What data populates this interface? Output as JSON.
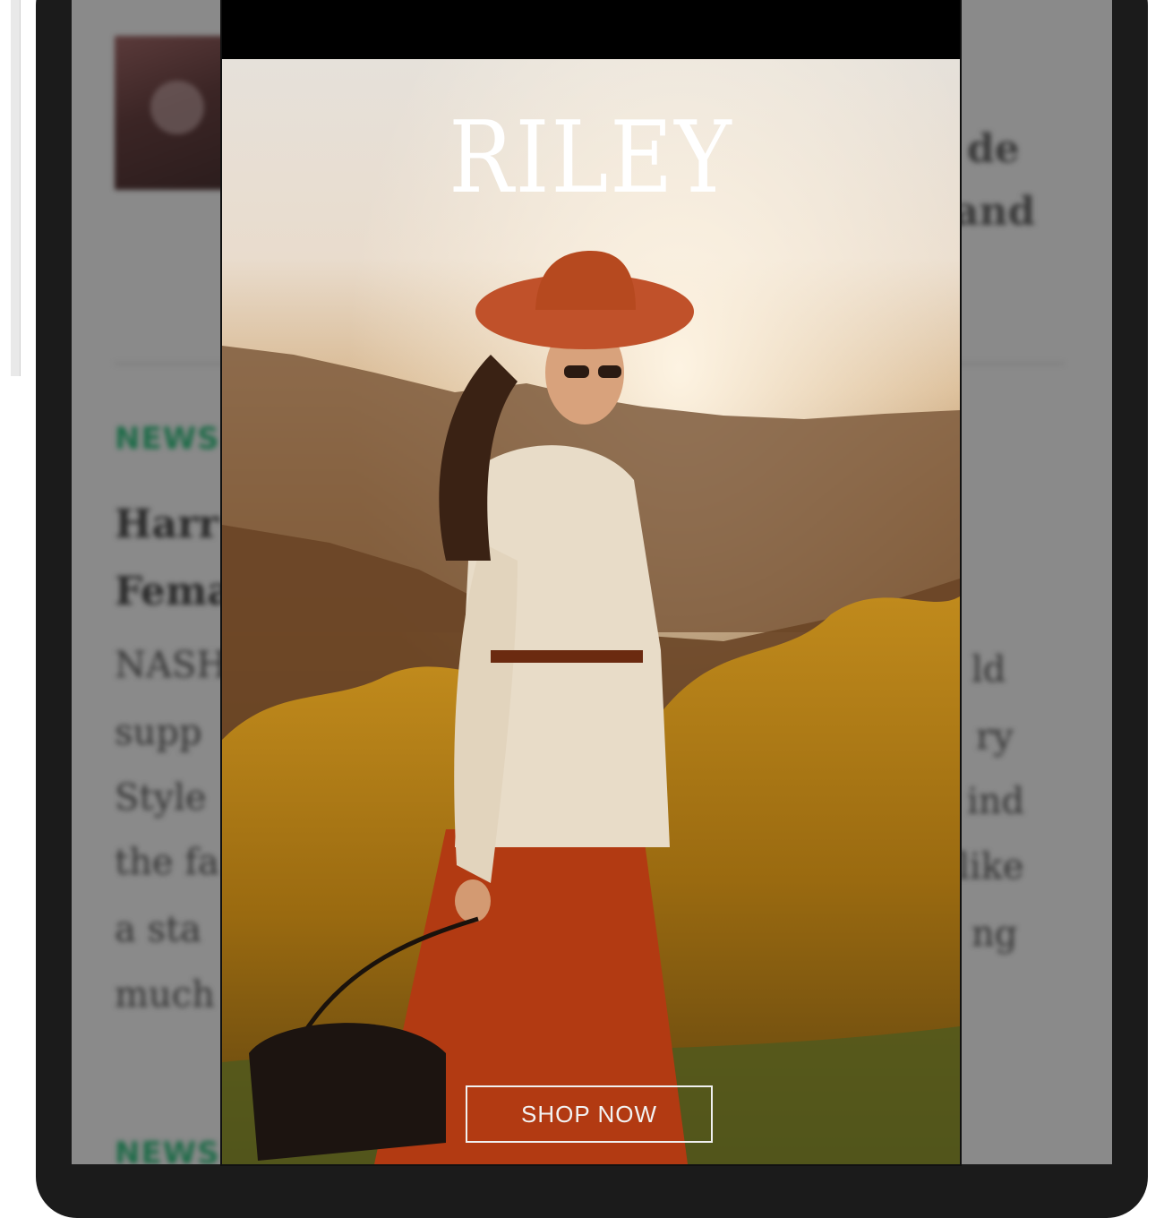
{
  "ad": {
    "brand": "RILEY",
    "cta_label": "SHOP NOW"
  },
  "background_article": {
    "tag_top": "NEWS",
    "tag_bottom": "NEWS",
    "headline_fragments": [
      "Harr",
      "Fema"
    ],
    "body_fragments": [
      "NASH",
      "supp",
      "Style",
      "the fa",
      "a sta",
      "much"
    ],
    "right_fragments": [
      "de",
      "and",
      "ld",
      "ry",
      "ind",
      "like",
      "ng"
    ]
  },
  "colors": {
    "tag_green": "#1e6b48",
    "overlay_dim": "#8a8a8a"
  }
}
